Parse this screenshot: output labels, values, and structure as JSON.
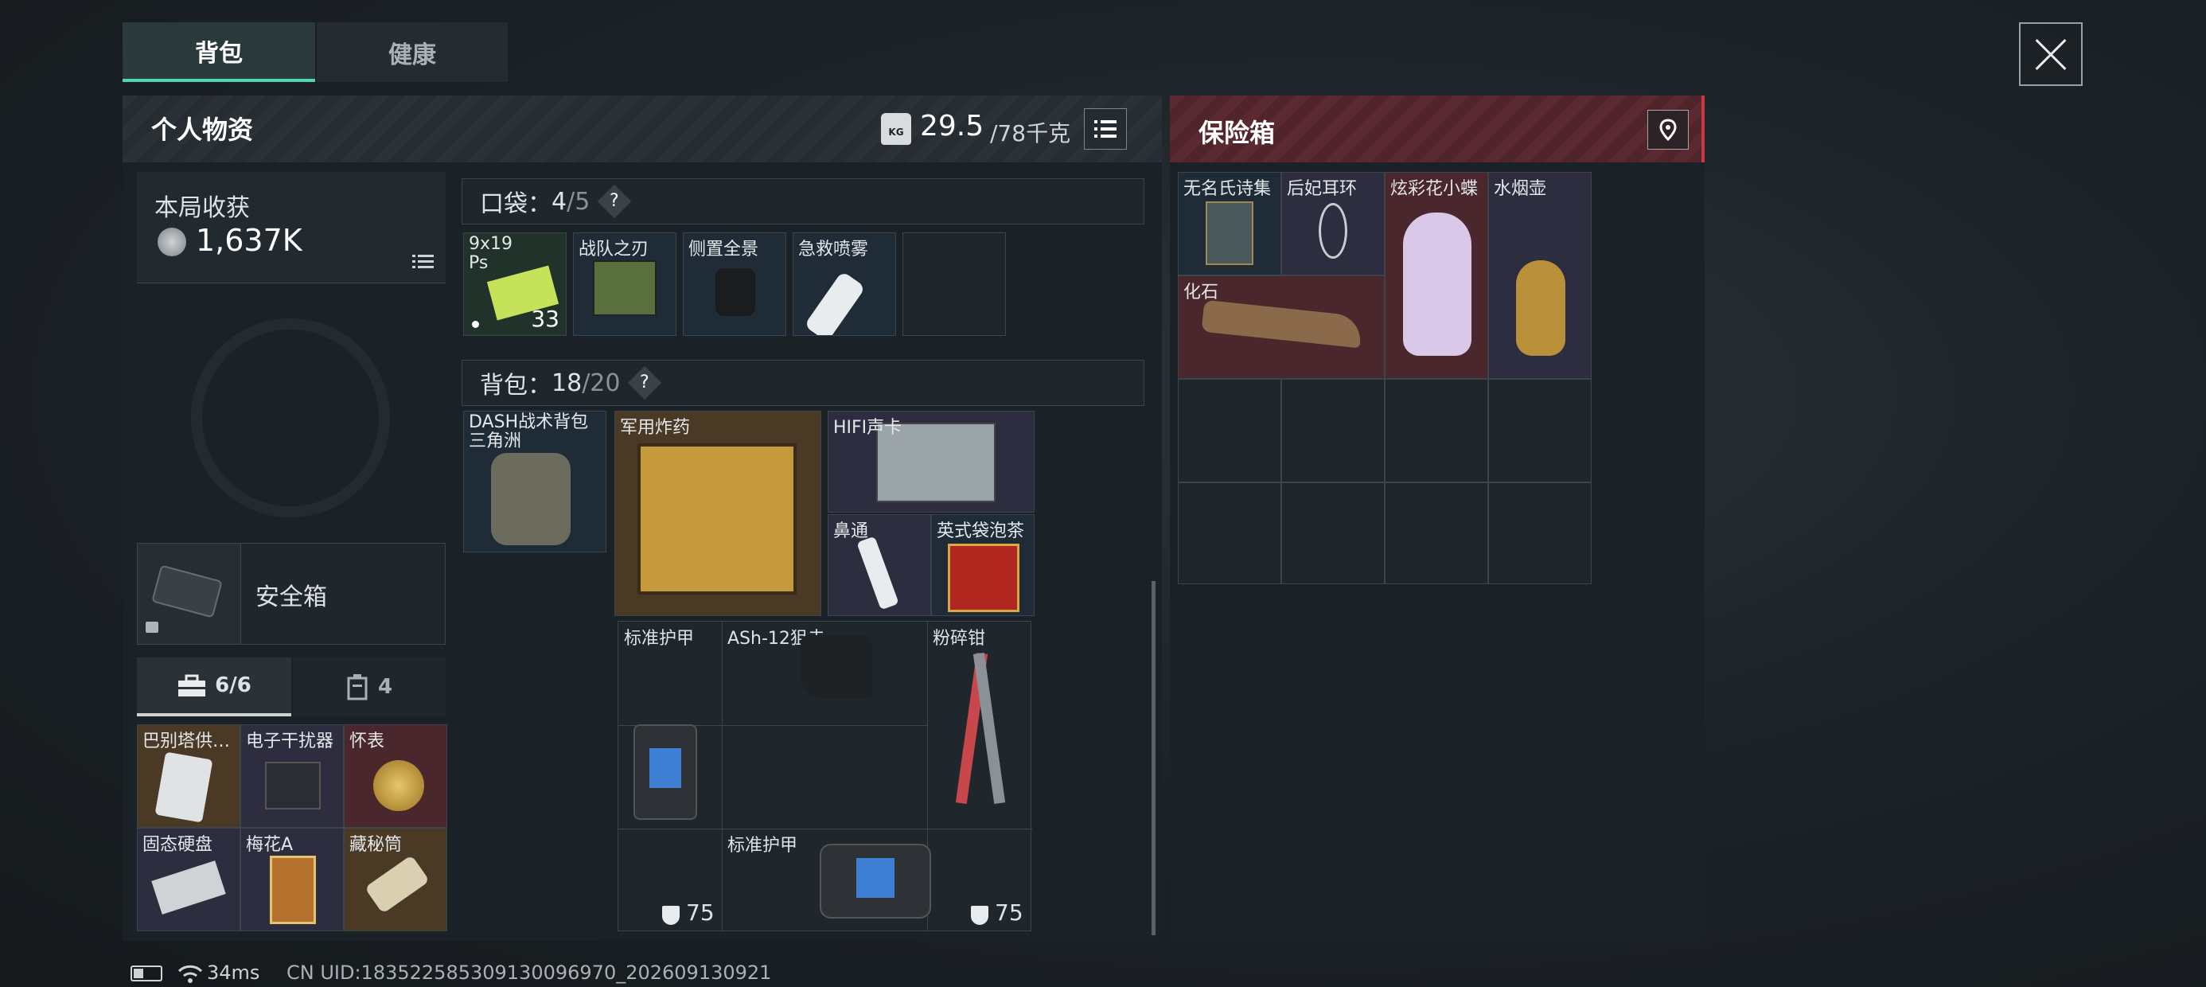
{
  "tabs": [
    {
      "label": "背包",
      "active": true
    },
    {
      "label": "健康",
      "active": false
    }
  ],
  "personal": {
    "title": "个人物资",
    "weight": "29.5",
    "weight_max": "/78千克",
    "kg_icon_label": "KG"
  },
  "earnings": {
    "label": "本局收获",
    "value": "1,637K"
  },
  "safe_box": {
    "label": "安全箱"
  },
  "subtabs": [
    {
      "label": "6/6",
      "icon": "toolbox-icon"
    },
    {
      "label": "4",
      "icon": "bag-icon"
    }
  ],
  "toolbox_items": [
    {
      "label": "巴别塔供…",
      "color": "#4a3a25"
    },
    {
      "label": "电子干扰器",
      "color": "#2e2c3f"
    },
    {
      "label": "怀表",
      "color": "#4a272c"
    },
    {
      "label": "固态硬盘",
      "color": "#2e2c3f"
    },
    {
      "label": "梅花A",
      "color": "#2e2c3f"
    },
    {
      "label": "藏秘筒",
      "color": "#4a3a25"
    }
  ],
  "pocket": {
    "label": "口袋：",
    "count": "4",
    "max": "/5",
    "help": "?"
  },
  "pocket_items": [
    {
      "label": "9x19",
      "sub": "Ps",
      "count": "33"
    },
    {
      "label": "战队之刃"
    },
    {
      "label": "侧置全景"
    },
    {
      "label": "急救喷雾"
    }
  ],
  "backpack": {
    "label": "背包：",
    "count": "18",
    "max": "/20",
    "help": "?"
  },
  "backpack_items": [
    {
      "label": "DASH战术背包",
      "sub": "三角洲"
    },
    {
      "label": "军用炸药"
    },
    {
      "label": "HIFI声卡"
    },
    {
      "label": "鼻通"
    },
    {
      "label": "英式袋泡茶"
    }
  ],
  "armor_items": [
    {
      "label": "标准护甲",
      "durability": "75"
    },
    {
      "label": "ASh-12狙击"
    },
    {
      "label": "粉碎钳"
    },
    {
      "label": "标准护甲",
      "durability": "75"
    }
  ],
  "insurance": {
    "title": "保险箱"
  },
  "insurance_items": [
    {
      "label": "无名氏诗集"
    },
    {
      "label": "后妃耳环"
    },
    {
      "label": "炫彩花小蝶"
    },
    {
      "label": "水烟壶"
    },
    {
      "label": "化石"
    }
  ],
  "status": {
    "ping": "34ms",
    "uid": "CN UID:1835225853091300969​70_202609130921"
  }
}
